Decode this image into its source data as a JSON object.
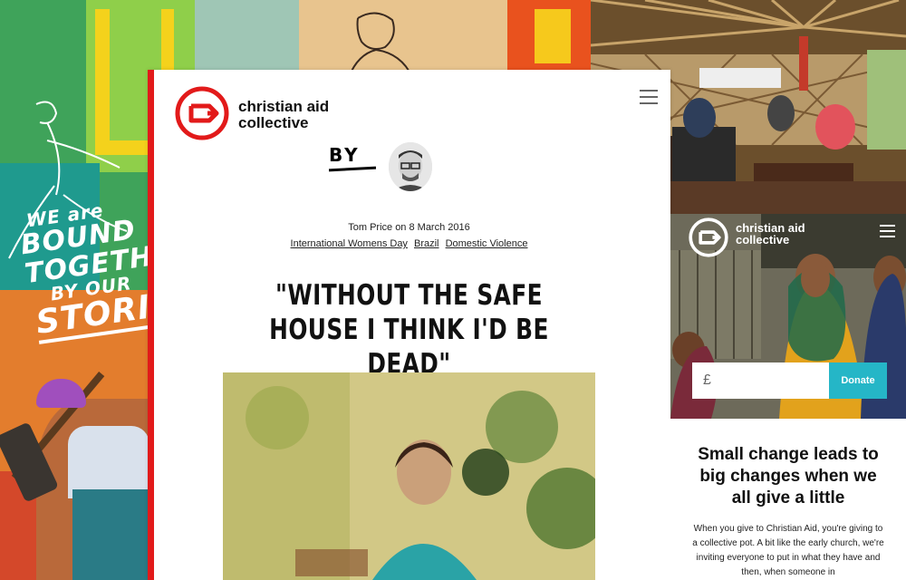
{
  "collage": {
    "slogan": [
      "WE are",
      "BOUND",
      "TOGETHER",
      "BY OUR",
      "STORIES"
    ]
  },
  "article": {
    "brand_line1": "christian aid",
    "brand_line2": "collective",
    "by_label": "BY",
    "author_line": "Tom Price on 8 March 2016",
    "tags": [
      "International Womens Day",
      "Brazil",
      "Domestic Violence"
    ],
    "headline": "\"WITHOUT THE SAFE HOUSE I THINK I'D BE DEAD\"",
    "accent_color": "#e21a1a"
  },
  "mobile": {
    "brand_line1": "christian aid",
    "brand_line2": "collective",
    "currency_placeholder": "£",
    "donate_label": "Donate",
    "donate_color": "#25b6c7",
    "headline": "Small change leads to big changes when we all give a little",
    "body": "When you give to Christian Aid, you're giving to a collective pot. A bit like the early church, we're inviting everyone to put in what they have and then, when someone in"
  }
}
